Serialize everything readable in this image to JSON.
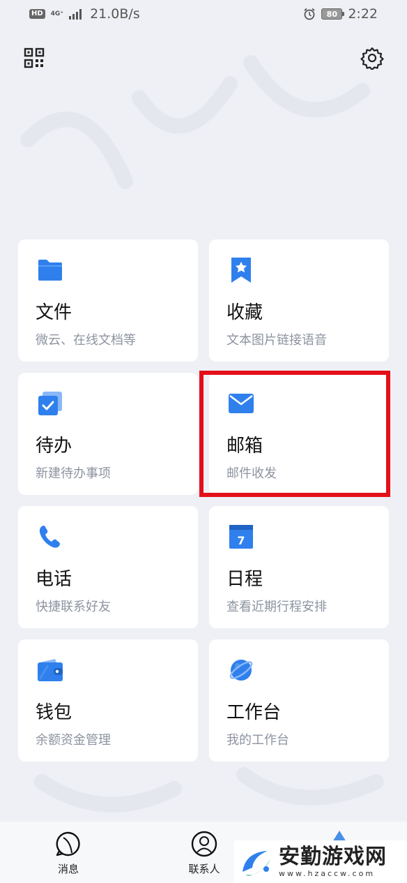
{
  "status_bar": {
    "hd": "HD",
    "network": "4G⁺",
    "speed": "21.0B/s",
    "battery": "80",
    "time": "2:22"
  },
  "cards": [
    {
      "title": "文件",
      "subtitle": "微云、在线文档等",
      "icon": "folder-icon"
    },
    {
      "title": "收藏",
      "subtitle": "文本图片链接语音",
      "icon": "bookmark-star-icon"
    },
    {
      "title": "待办",
      "subtitle": "新建待办事项",
      "icon": "todo-check-icon"
    },
    {
      "title": "邮箱",
      "subtitle": "邮件收发",
      "icon": "mail-icon"
    },
    {
      "title": "电话",
      "subtitle": "快捷联系好友",
      "icon": "phone-icon"
    },
    {
      "title": "日程",
      "subtitle": "查看近期行程安排",
      "icon": "calendar-icon",
      "icon_text": "7"
    },
    {
      "title": "钱包",
      "subtitle": "余额资金管理",
      "icon": "wallet-icon"
    },
    {
      "title": "工作台",
      "subtitle": "我的工作台",
      "icon": "planet-icon"
    }
  ],
  "bottom_nav": {
    "messages": "消息",
    "contacts": "联系人"
  },
  "watermark": {
    "title": "安勤游戏网",
    "url": "www.hzaccw.com"
  },
  "colors": {
    "accent": "#2f80ed",
    "highlight": "#e3101a",
    "background": "#eef0f5"
  }
}
